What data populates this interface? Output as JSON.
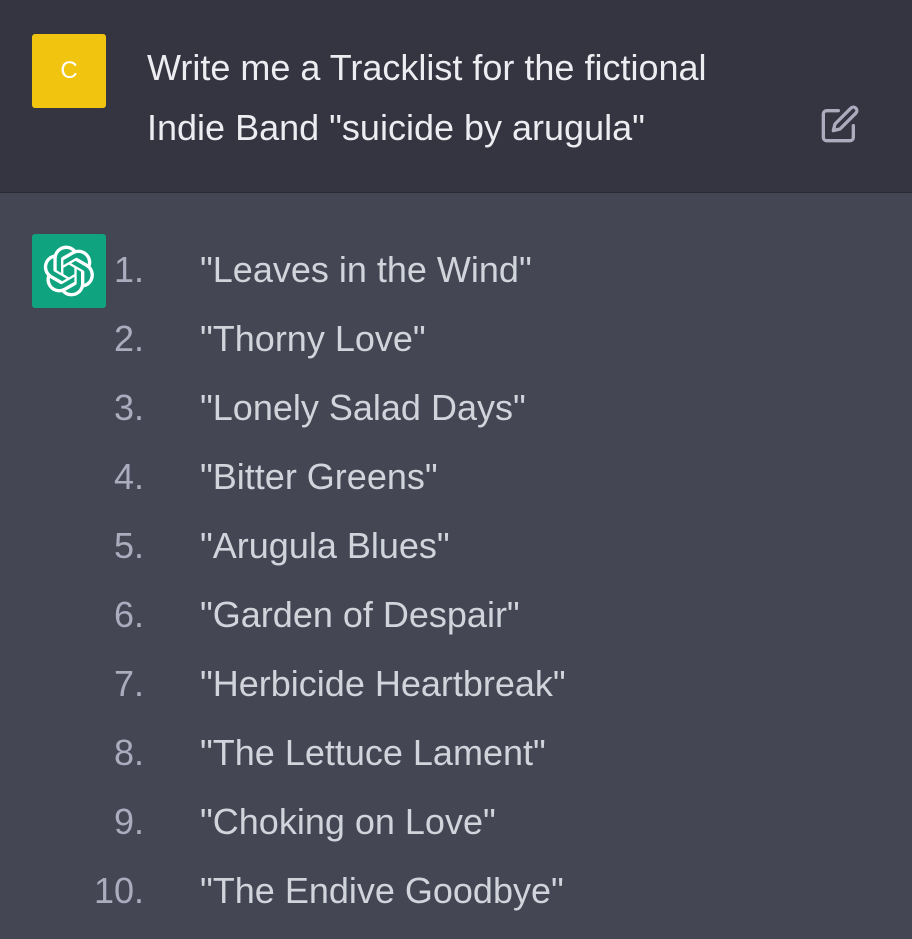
{
  "user": {
    "avatar_letter": "C",
    "avatar_color": "#f1c40f",
    "message_line1": "Write me a Tracklist for the fictional",
    "message_line2": "Indie Band \"suicide by arugula\"",
    "edit_icon": "edit-icon"
  },
  "assistant": {
    "avatar_icon": "openai-logo-icon",
    "avatar_color": "#10a37f",
    "tracks": [
      {
        "num": "1.",
        "title": "\"Leaves in the Wind\""
      },
      {
        "num": "2.",
        "title": "\"Thorny Love\""
      },
      {
        "num": "3.",
        "title": "\"Lonely Salad Days\""
      },
      {
        "num": "4.",
        "title": "\"Bitter Greens\""
      },
      {
        "num": "5.",
        "title": "\"Arugula Blues\""
      },
      {
        "num": "6.",
        "title": "\"Garden of Despair\""
      },
      {
        "num": "7.",
        "title": "\"Herbicide Heartbreak\""
      },
      {
        "num": "8.",
        "title": "\"The Lettuce Lament\""
      },
      {
        "num": "9.",
        "title": "\"Choking on Love\""
      },
      {
        "num": "10.",
        "title": "\"The Endive Goodbye\""
      }
    ]
  },
  "colors": {
    "user_bg": "#343541",
    "assistant_bg": "#444654",
    "text": "#d1d5db"
  }
}
